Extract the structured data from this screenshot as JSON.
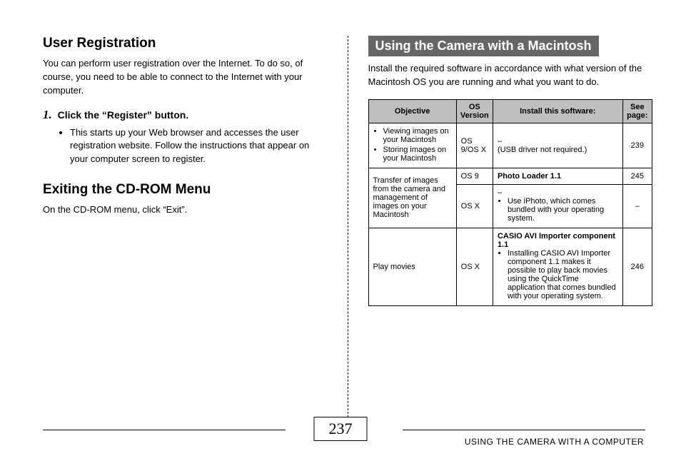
{
  "left": {
    "sec1_title": "User Registration",
    "sec1_body": "You can perform user registration over the Internet. To do so, of course, you need to be able to connect to the Internet with your computer.",
    "step_num": "1.",
    "step_text": "Click the “Register” button.",
    "step_bullet": "This starts up your Web browser and accesses the user registration website. Follow the instructions that appear on your computer screen to register.",
    "sec2_title": "Exiting the CD-ROM Menu",
    "sec2_body": "On the CD-ROM menu, click “Exit”."
  },
  "right": {
    "banner": "Using the Camera with a Macintosh",
    "intro": "Install the required software in accordance with what version of the Macintosh OS you are running and what you want to do.",
    "headers": [
      "Objective",
      "OS Version",
      "Install this software:",
      "See page:"
    ],
    "rows": [
      {
        "objective_items": [
          "Viewing images on your Macintosh",
          "Storing images on your Macintosh"
        ],
        "os": "OS 9/OS X",
        "software_plain": "–\n(USB driver not required.)",
        "page": "239"
      },
      {
        "objective_text": "Transfer of images from the camera and management of images on your Macintosh",
        "os": "OS 9",
        "software_bold": "Photo Loader 1.1",
        "page": "245",
        "rowspan_obj": 2
      },
      {
        "os": "OS X",
        "software_dash": "–",
        "software_items": [
          "Use iPhoto, which comes bundled with your operating system."
        ],
        "page": "–"
      },
      {
        "objective_text": "Play movies",
        "os": "OS X",
        "software_bold": "CASIO AVI Importer component 1.1",
        "software_items": [
          "Installing CASIO AVI Importer component 1.1 makes it possible to play back movies using the QuickTime application that comes bundled with your operating system."
        ],
        "page": "246"
      }
    ]
  },
  "footer": {
    "page_number": "237",
    "label": "USING THE CAMERA WITH A COMPUTER"
  }
}
